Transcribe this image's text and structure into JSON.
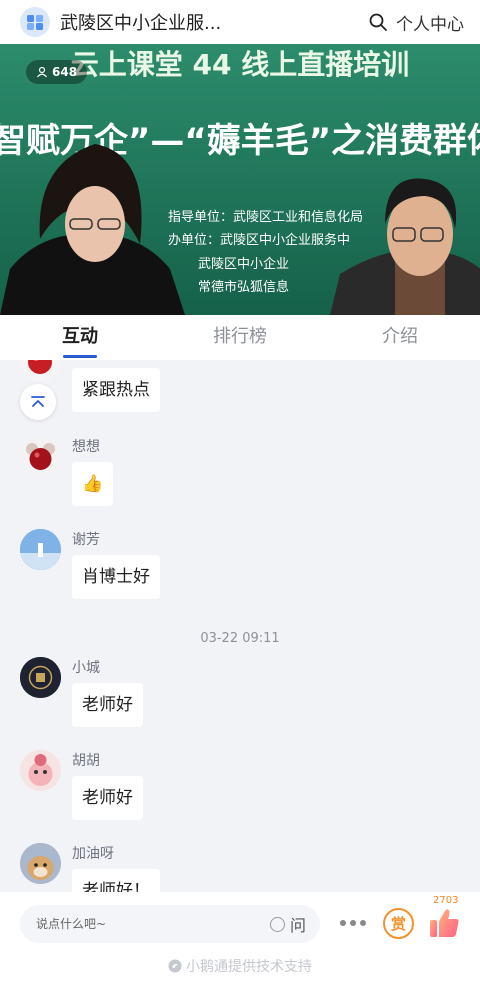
{
  "header": {
    "title": "武陵区中小企业服...",
    "user_center": "个人中心"
  },
  "video": {
    "viewer_count": "648",
    "banner_line1": "云上课堂 44 线上直播培训",
    "banner_line2": "智赋万企”—“薅羊毛”之消费群体高效",
    "info_lines": [
      "指导单位：武陵区工业和信息化局",
      "办单位：武陵区中小企业服务中",
      "武陵区中小企业",
      "常德市弘狐信息"
    ]
  },
  "tabs": [
    {
      "label": "互动",
      "active": true
    },
    {
      "label": "排行榜",
      "active": false
    },
    {
      "label": "介绍",
      "active": false
    }
  ],
  "chat": {
    "messages": [
      {
        "nickname": "",
        "text": "紧跟热点",
        "avatar": "red-ornament-avatar"
      },
      {
        "nickname": "想想",
        "text": "👍",
        "avatar": "red-mouse-avatar"
      },
      {
        "nickname": "谢芳",
        "text": "肖博士好",
        "avatar": "sky-avatar"
      },
      {
        "nickname": "小城",
        "text": "老师好",
        "avatar": "dark-avatar"
      },
      {
        "nickname": "胡胡",
        "text": "老师好",
        "avatar": "pink-cartoon-avatar"
      },
      {
        "nickname": "加油呀",
        "text": "老师好！",
        "avatar": "dog-avatar"
      }
    ],
    "timestamp": "03-22 09:11"
  },
  "bottom": {
    "input_placeholder": "说点什么吧~",
    "ask_label": "问",
    "reward_label": "赏",
    "like_count": "2703",
    "powered_by": "小鹅通提供技术支持"
  },
  "colors": {
    "accent": "#2a5bd7",
    "reward": "#f4912b",
    "like": "#ff6a7d",
    "video_bg": "#1d7a5c"
  }
}
